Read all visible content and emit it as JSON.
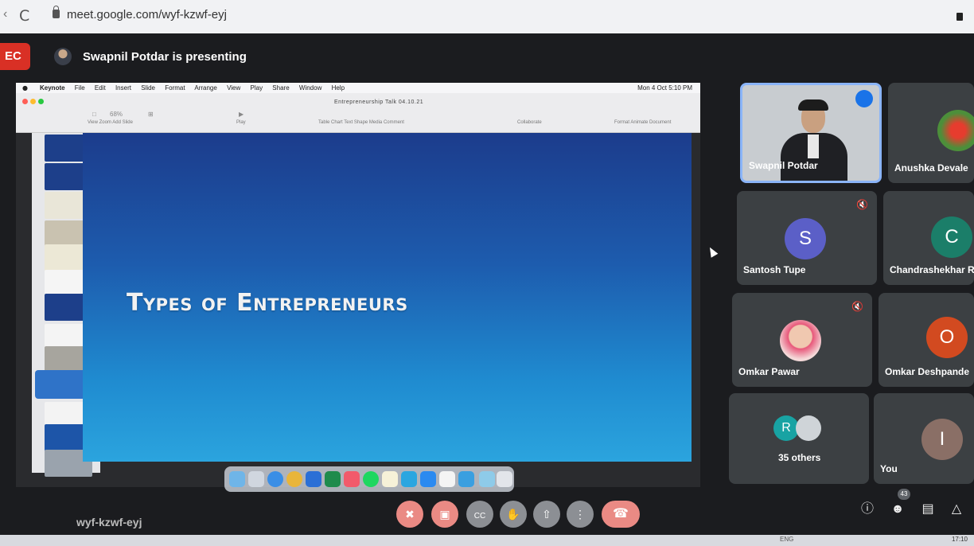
{
  "browser": {
    "url": "meet.google.com/wyf-kzwf-eyj"
  },
  "meet": {
    "rec_label": "EC",
    "presenting_text": "Swapnil Potdar is presenting",
    "meeting_code": "wyf-kzwf-eyj",
    "participant_count": "43"
  },
  "keynote": {
    "menubar": [
      "Keynote",
      "File",
      "Edit",
      "Insert",
      "Slide",
      "Format",
      "Arrange",
      "View",
      "Play",
      "Share",
      "Window",
      "Help"
    ],
    "status_right": "Mon 4 Oct  5:10 PM",
    "doc_title": "Entrepreneurship Talk 04.10.21",
    "toolbar_left": "View    Zoom    Add Slide",
    "zoom": "68%",
    "toolbar_play": "Play",
    "toolbar_middle": "Table   Chart   Text   Shape   Media   Comment",
    "toolbar_collab": "Collaborate",
    "toolbar_right": "Format    Animate    Document",
    "slide_title": "Types of Entrepreneurs"
  },
  "participants": [
    {
      "name": "Swapnil Potdar"
    },
    {
      "name": "Anushka Devale"
    },
    {
      "name": "Santosh Tupe",
      "initial": "S",
      "color": "#5b5fc7"
    },
    {
      "name": "Chandrashekhar Ro",
      "initial": "C",
      "color": "#1b7e69"
    },
    {
      "name": "Omkar Pawar"
    },
    {
      "name": "Omkar Deshpande",
      "initial": "O",
      "color": "#d24a20"
    },
    {
      "name": "35 others",
      "initial": "R",
      "color": "#18a3a3"
    },
    {
      "name": "You",
      "initial": "I",
      "color": "#8a6f66"
    }
  ],
  "taskbar": {
    "lang": "ENG",
    "time": "17:10"
  }
}
